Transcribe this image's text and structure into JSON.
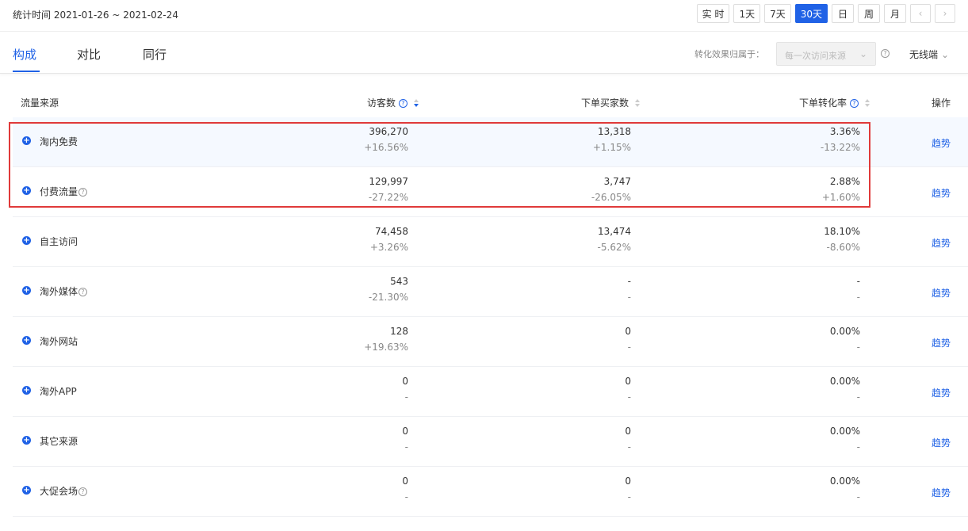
{
  "header": {
    "date_range": "统计时间 2021-01-26 ~ 2021-02-24",
    "range_buttons": [
      "实 时",
      "1天",
      "7天",
      "30天",
      "日",
      "周",
      "月"
    ],
    "active_range": "30天",
    "prev_icon": "chevron-left-icon",
    "next_icon": "chevron-right-icon"
  },
  "tabs": [
    {
      "label": "构成"
    },
    {
      "label": "对比"
    },
    {
      "label": "同行"
    }
  ],
  "attribution": {
    "label": "转化效果归属于：",
    "select_value": "每一次访问来源",
    "device": "无线端"
  },
  "table": {
    "headers": {
      "source": "流量来源",
      "visitors": "访客数",
      "buyers": "下单买家数",
      "conversion": "下单转化率",
      "action": "操作"
    },
    "rows": [
      {
        "name": "淘内免费",
        "help": false,
        "visitors": "396,270",
        "visitors_delta": "+16.56%",
        "buyers": "13,318",
        "buyers_delta": "+1.15%",
        "conv": "3.36%",
        "conv_delta": "-13.22%",
        "action": "趋势"
      },
      {
        "name": "付费流量",
        "help": true,
        "visitors": "129,997",
        "visitors_delta": "-27.22%",
        "buyers": "3,747",
        "buyers_delta": "-26.05%",
        "conv": "2.88%",
        "conv_delta": "+1.60%",
        "action": "趋势"
      },
      {
        "name": "自主访问",
        "help": false,
        "visitors": "74,458",
        "visitors_delta": "+3.26%",
        "buyers": "13,474",
        "buyers_delta": "-5.62%",
        "conv": "18.10%",
        "conv_delta": "-8.60%",
        "action": "趋势"
      },
      {
        "name": "淘外媒体",
        "help": true,
        "visitors": "543",
        "visitors_delta": "-21.30%",
        "buyers": "-",
        "buyers_delta": "-",
        "conv": "-",
        "conv_delta": "-",
        "action": "趋势"
      },
      {
        "name": "淘外网站",
        "help": false,
        "visitors": "128",
        "visitors_delta": "+19.63%",
        "buyers": "0",
        "buyers_delta": "-",
        "conv": "0.00%",
        "conv_delta": "-",
        "action": "趋势"
      },
      {
        "name": "淘外APP",
        "help": false,
        "visitors": "0",
        "visitors_delta": "-",
        "buyers": "0",
        "buyers_delta": "-",
        "conv": "0.00%",
        "conv_delta": "-",
        "action": "趋势"
      },
      {
        "name": "其它来源",
        "help": false,
        "visitors": "0",
        "visitors_delta": "-",
        "buyers": "0",
        "buyers_delta": "-",
        "conv": "0.00%",
        "conv_delta": "-",
        "action": "趋势"
      },
      {
        "name": "大促会场",
        "help": true,
        "visitors": "0",
        "visitors_delta": "-",
        "buyers": "0",
        "buyers_delta": "-",
        "conv": "0.00%",
        "conv_delta": "-",
        "action": "趋势"
      }
    ]
  },
  "colors": {
    "accent": "#2062e6",
    "highlight_border": "#e03a3a",
    "row_highlight": "#f5f9ff"
  }
}
